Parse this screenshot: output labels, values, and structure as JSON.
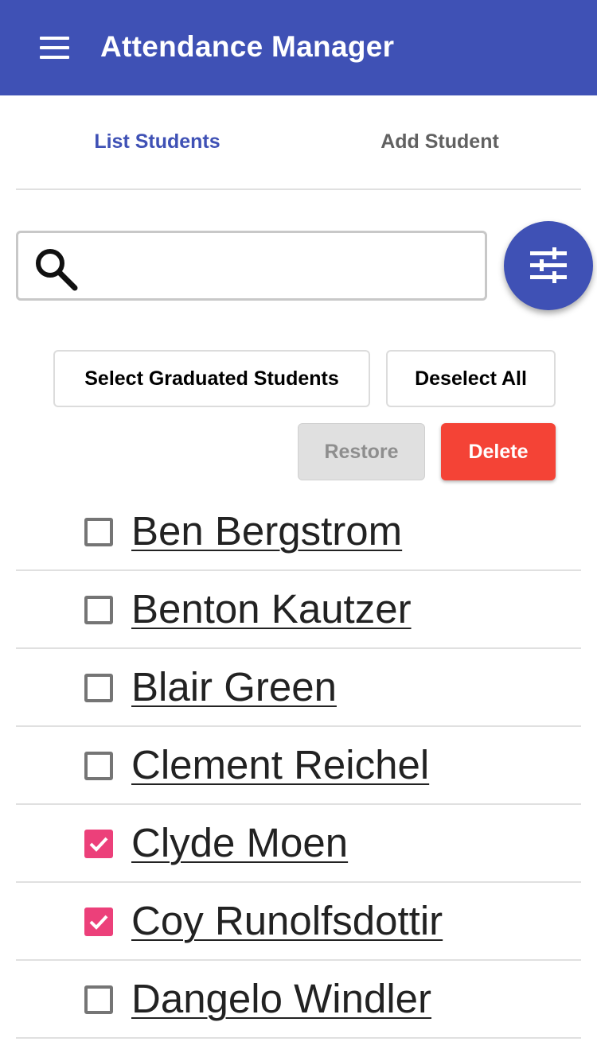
{
  "app": {
    "title": "Attendance Manager"
  },
  "tabs": [
    {
      "label": "List Students",
      "active": true
    },
    {
      "label": "Add Student",
      "active": false
    }
  ],
  "search": {
    "value": "",
    "placeholder": ""
  },
  "actions": {
    "select_graduated": "Select Graduated Students",
    "deselect_all": "Deselect All",
    "restore": "Restore",
    "delete": "Delete"
  },
  "students": [
    {
      "name": "Ben Bergstrom",
      "checked": false
    },
    {
      "name": "Benton Kautzer",
      "checked": false
    },
    {
      "name": "Blair Green",
      "checked": false
    },
    {
      "name": "Clement Reichel",
      "checked": false
    },
    {
      "name": "Clyde Moen",
      "checked": true
    },
    {
      "name": "Coy Runolfsdottir",
      "checked": true
    },
    {
      "name": "Dangelo Windler",
      "checked": false
    }
  ],
  "colors": {
    "primary": "#3F51B5",
    "accent": "#EC407A",
    "danger": "#F44336"
  },
  "icons": [
    "menu-icon",
    "search-icon",
    "filter-icon",
    "check-icon"
  ]
}
